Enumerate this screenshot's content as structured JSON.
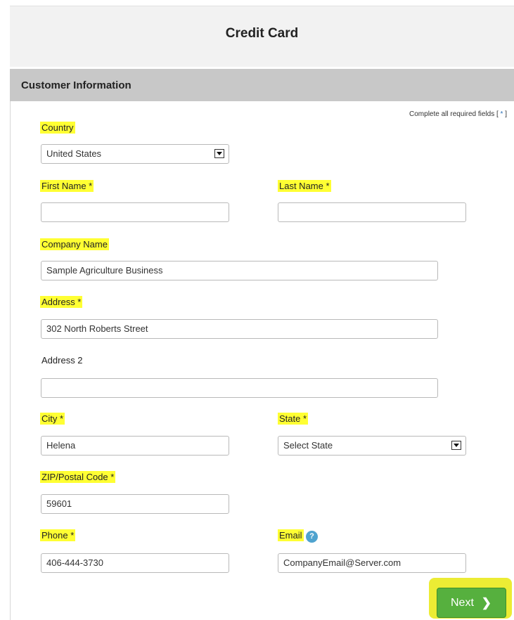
{
  "header": {
    "title": "Credit Card"
  },
  "section": {
    "title": "Customer Information"
  },
  "required_note": {
    "text": "Complete all required fields [",
    "star": "*",
    "close": "]"
  },
  "fields": {
    "country": {
      "label": "Country",
      "value": "United States"
    },
    "first_name": {
      "label": "First Name *",
      "value": ""
    },
    "last_name": {
      "label": "Last Name *",
      "value": ""
    },
    "company_name": {
      "label": "Company Name",
      "value": "Sample Agriculture Business"
    },
    "address": {
      "label": "Address *",
      "value": "302 North Roberts Street"
    },
    "address2": {
      "label": "Address 2",
      "value": ""
    },
    "city": {
      "label": "City *",
      "value": "Helena"
    },
    "state": {
      "label": "State *",
      "value": "Select State"
    },
    "zip": {
      "label": "ZIP/Postal Code *",
      "value": "59601"
    },
    "phone": {
      "label": "Phone *",
      "value": "406-444-3730"
    },
    "email": {
      "label": "Email",
      "value": "CompanyEmail@Server.com",
      "help_icon": "?"
    }
  },
  "next_button": {
    "label": "Next",
    "icon": "chevron-right-icon",
    "chevron": "❯"
  },
  "colors": {
    "highlight": "#ffff33",
    "button_green": "#56b03e",
    "header_bg": "#f2f2f2",
    "section_bar": "#c8c8c8",
    "help_blue": "#4fa3cf"
  }
}
